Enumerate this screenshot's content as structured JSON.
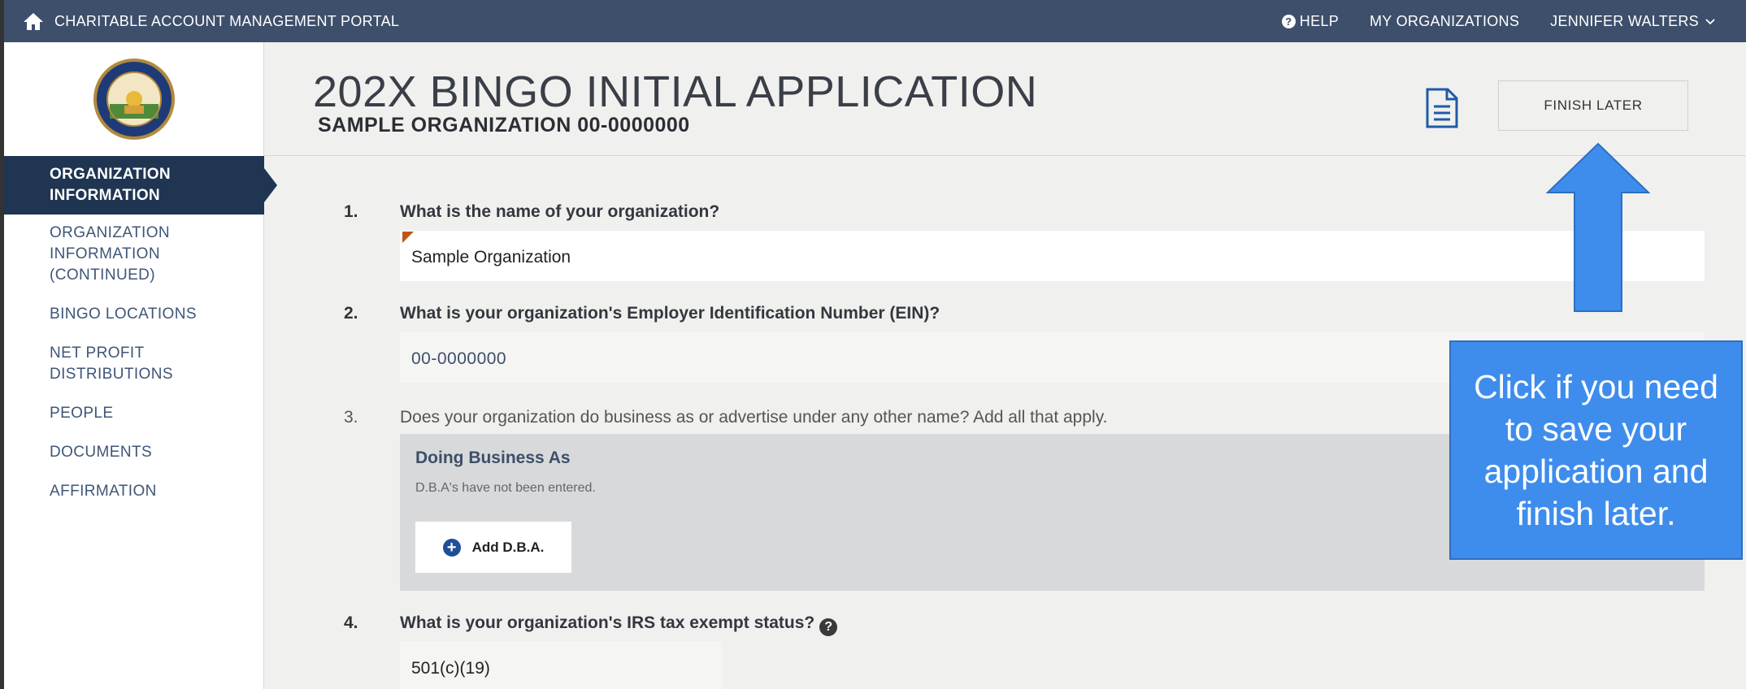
{
  "topnav": {
    "portal_title": "CHARITABLE ACCOUNT MANAGEMENT PORTAL",
    "help_label": "HELP",
    "my_orgs_label": "MY ORGANIZATIONS",
    "user_label": "JENNIFER WALTERS",
    "icons": [
      "home-icon",
      "help-icon",
      "chevron-down-icon"
    ]
  },
  "sidebar": {
    "active_label": "ORGANIZATION INFORMATION",
    "items": [
      {
        "label": "ORGANIZATION INFORMATION (CONTINUED)"
      },
      {
        "label": "BINGO LOCATIONS"
      },
      {
        "label": "NET PROFIT DISTRIBUTIONS"
      },
      {
        "label": "PEOPLE"
      },
      {
        "label": "DOCUMENTS"
      },
      {
        "label": "AFFIRMATION"
      }
    ]
  },
  "header": {
    "title": "202X BINGO INITIAL APPLICATION",
    "subtitle": "SAMPLE ORGANIZATION 00-0000000",
    "finish_later_label": "FINISH LATER"
  },
  "questions": [
    {
      "number": "1.",
      "text": "What is the name of your organization?",
      "value": "Sample Organization"
    },
    {
      "number": "2.",
      "text": "What is your organization's Employer Identification Number (EIN)?",
      "value": "00-0000000"
    },
    {
      "number": "3.",
      "text": "Does your organization do business as or advertise under any other name? Add all that apply.",
      "dba_title": "Doing Business As",
      "dba_empty": "D.B.A's have not been entered.",
      "add_label": "Add D.B.A."
    },
    {
      "number": "4.",
      "text": "What is your organization's IRS tax exempt status?",
      "value": "501(c)(19)"
    }
  ],
  "annotation": {
    "callout_text": "Click if you need to save your application and finish later."
  },
  "colors": {
    "topnav_bg": "#3d4f6b",
    "sidebar_active_bg": "#1f3552",
    "callout_bg": "#3e8ded",
    "required_flag": "#c0551a"
  }
}
